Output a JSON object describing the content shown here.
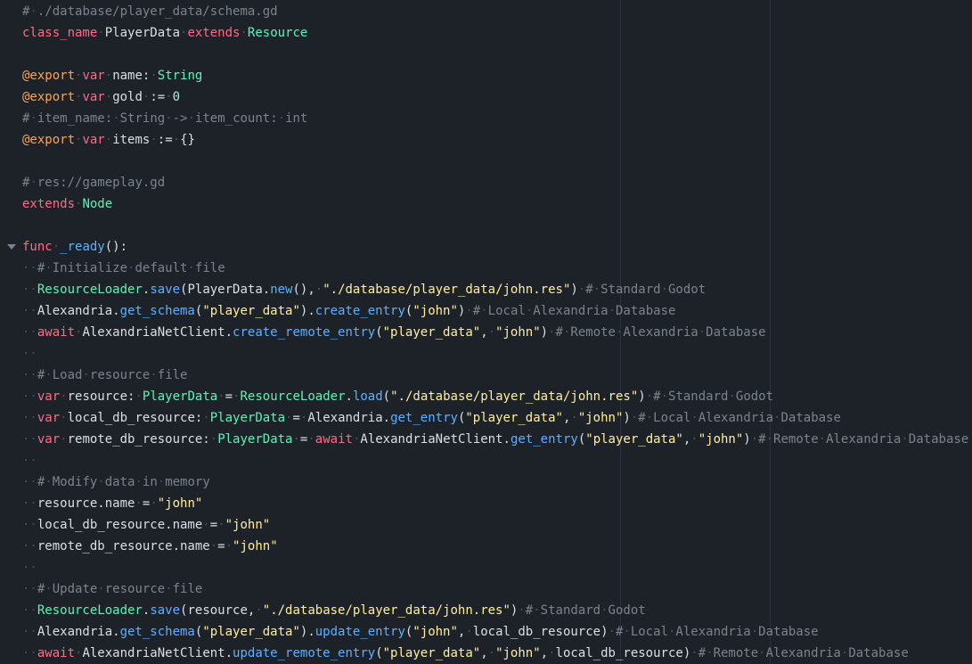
{
  "editor": {
    "colors": {
      "background": "#1d2229",
      "comment": "#7c838d",
      "keyword": "#ff6b84",
      "type": "#5ff2b6",
      "annotation": "#f7a35c",
      "function": "#5db0ff",
      "string": "#ffeea0",
      "number": "#a4f0d2",
      "text": "#dcdfe4",
      "whitespace_dot": "#4a515c"
    },
    "fold_icon": "chevron-down-icon",
    "lines": [
      {
        "indent": 0,
        "tokens": [
          [
            "c",
            "# ./database/player_data/schema.gd"
          ]
        ]
      },
      {
        "indent": 0,
        "tokens": [
          [
            "k",
            "class_name"
          ],
          [
            "t",
            " PlayerData "
          ],
          [
            "k",
            "extends"
          ],
          [
            "t",
            " "
          ],
          [
            "ty",
            "Resource"
          ]
        ]
      },
      {
        "indent": 0,
        "tokens": []
      },
      {
        "indent": 0,
        "tokens": [
          [
            "an",
            "@export"
          ],
          [
            "t",
            " "
          ],
          [
            "k",
            "var"
          ],
          [
            "t",
            " name: "
          ],
          [
            "ty",
            "String"
          ]
        ]
      },
      {
        "indent": 0,
        "tokens": [
          [
            "an",
            "@export"
          ],
          [
            "t",
            " "
          ],
          [
            "k",
            "var"
          ],
          [
            "t",
            " gold := "
          ],
          [
            "num",
            "0"
          ]
        ]
      },
      {
        "indent": 0,
        "tokens": [
          [
            "c",
            "# item_name: String -> item_count: int"
          ]
        ]
      },
      {
        "indent": 0,
        "tokens": [
          [
            "an",
            "@export"
          ],
          [
            "t",
            " "
          ],
          [
            "k",
            "var"
          ],
          [
            "t",
            " items := {}"
          ]
        ]
      },
      {
        "indent": 0,
        "tokens": []
      },
      {
        "indent": 0,
        "tokens": [
          [
            "c",
            "# res://gameplay.gd"
          ]
        ]
      },
      {
        "indent": 0,
        "tokens": [
          [
            "k",
            "extends"
          ],
          [
            "t",
            " "
          ],
          [
            "ty",
            "Node"
          ]
        ]
      },
      {
        "indent": 0,
        "tokens": []
      },
      {
        "indent": 0,
        "fold": true,
        "tokens": [
          [
            "k",
            "func"
          ],
          [
            "t",
            " "
          ],
          [
            "fn",
            "_ready"
          ],
          [
            "t",
            "():"
          ]
        ]
      },
      {
        "indent": 1,
        "tokens": [
          [
            "c",
            "# Initialize default file"
          ]
        ]
      },
      {
        "indent": 1,
        "tokens": [
          [
            "ty",
            "ResourceLoader"
          ],
          [
            "t",
            "."
          ],
          [
            "fn",
            "save"
          ],
          [
            "t",
            "(PlayerData."
          ],
          [
            "fn",
            "new"
          ],
          [
            "t",
            "(), "
          ],
          [
            "str",
            "\"./database/player_data/john.res\""
          ],
          [
            "t",
            ") "
          ],
          [
            "c",
            "# Standard Godot"
          ]
        ]
      },
      {
        "indent": 1,
        "tokens": [
          [
            "t",
            "Alexandria."
          ],
          [
            "fn",
            "get_schema"
          ],
          [
            "t",
            "("
          ],
          [
            "str",
            "\"player_data\""
          ],
          [
            "t",
            ")."
          ],
          [
            "fn",
            "create_entry"
          ],
          [
            "t",
            "("
          ],
          [
            "str",
            "\"john\""
          ],
          [
            "t",
            ") "
          ],
          [
            "c",
            "# Local Alexandria Database"
          ]
        ]
      },
      {
        "indent": 1,
        "tokens": [
          [
            "k",
            "await"
          ],
          [
            "t",
            " AlexandriaNetClient."
          ],
          [
            "fn",
            "create_remote_entry"
          ],
          [
            "t",
            "("
          ],
          [
            "str",
            "\"player_data\""
          ],
          [
            "t",
            ", "
          ],
          [
            "str",
            "\"john\""
          ],
          [
            "t",
            ") "
          ],
          [
            "c",
            "# Remote Alexandria Database"
          ]
        ]
      },
      {
        "indent": 1,
        "tokens": []
      },
      {
        "indent": 1,
        "tokens": [
          [
            "c",
            "# Load resource file"
          ]
        ]
      },
      {
        "indent": 1,
        "tokens": [
          [
            "k",
            "var"
          ],
          [
            "t",
            " resource: "
          ],
          [
            "ty",
            "PlayerData"
          ],
          [
            "t",
            " = "
          ],
          [
            "ty",
            "ResourceLoader"
          ],
          [
            "t",
            "."
          ],
          [
            "fn",
            "load"
          ],
          [
            "t",
            "("
          ],
          [
            "str",
            "\"./database/player_data/john.res\""
          ],
          [
            "t",
            ") "
          ],
          [
            "c",
            "# Standard Godot"
          ]
        ]
      },
      {
        "indent": 1,
        "tokens": [
          [
            "k",
            "var"
          ],
          [
            "t",
            " local_db_resource: "
          ],
          [
            "ty",
            "PlayerData"
          ],
          [
            "t",
            " = Alexandria."
          ],
          [
            "fn",
            "get_entry"
          ],
          [
            "t",
            "("
          ],
          [
            "str",
            "\"player_data\""
          ],
          [
            "t",
            ", "
          ],
          [
            "str",
            "\"john\""
          ],
          [
            "t",
            ") "
          ],
          [
            "c",
            "# Local Alexandria Database"
          ]
        ]
      },
      {
        "indent": 1,
        "tokens": [
          [
            "k",
            "var"
          ],
          [
            "t",
            " remote_db_resource: "
          ],
          [
            "ty",
            "PlayerData"
          ],
          [
            "t",
            " = "
          ],
          [
            "k",
            "await"
          ],
          [
            "t",
            " AlexandriaNetClient."
          ],
          [
            "fn",
            "get_entry"
          ],
          [
            "t",
            "("
          ],
          [
            "str",
            "\"player_data\""
          ],
          [
            "t",
            ", "
          ],
          [
            "str",
            "\"john\""
          ],
          [
            "t",
            ") "
          ],
          [
            "c",
            "# Remote Alexandria Database"
          ]
        ]
      },
      {
        "indent": 1,
        "tokens": []
      },
      {
        "indent": 1,
        "tokens": [
          [
            "c",
            "# Modify data in memory"
          ]
        ]
      },
      {
        "indent": 1,
        "tokens": [
          [
            "t",
            "resource.name = "
          ],
          [
            "str",
            "\"john\""
          ]
        ]
      },
      {
        "indent": 1,
        "tokens": [
          [
            "t",
            "local_db_resource.name = "
          ],
          [
            "str",
            "\"john\""
          ]
        ]
      },
      {
        "indent": 1,
        "tokens": [
          [
            "t",
            "remote_db_resource.name = "
          ],
          [
            "str",
            "\"john\""
          ]
        ]
      },
      {
        "indent": 1,
        "tokens": []
      },
      {
        "indent": 1,
        "tokens": [
          [
            "c",
            "# Update resource file"
          ]
        ]
      },
      {
        "indent": 1,
        "tokens": [
          [
            "ty",
            "ResourceLoader"
          ],
          [
            "t",
            "."
          ],
          [
            "fn",
            "save"
          ],
          [
            "t",
            "(resource, "
          ],
          [
            "str",
            "\"./database/player_data/john.res\""
          ],
          [
            "t",
            ") "
          ],
          [
            "c",
            "# Standard Godot"
          ]
        ]
      },
      {
        "indent": 1,
        "tokens": [
          [
            "t",
            "Alexandria."
          ],
          [
            "fn",
            "get_schema"
          ],
          [
            "t",
            "("
          ],
          [
            "str",
            "\"player_data\""
          ],
          [
            "t",
            ")."
          ],
          [
            "fn",
            "update_entry"
          ],
          [
            "t",
            "("
          ],
          [
            "str",
            "\"john\""
          ],
          [
            "t",
            ", local_db_resource) "
          ],
          [
            "c",
            "# Local Alexandria Database"
          ]
        ]
      },
      {
        "indent": 1,
        "tokens": [
          [
            "k",
            "await"
          ],
          [
            "t",
            " AlexandriaNetClient."
          ],
          [
            "fn",
            "update_remote_entry"
          ],
          [
            "t",
            "("
          ],
          [
            "str",
            "\"player_data\""
          ],
          [
            "t",
            ", "
          ],
          [
            "str",
            "\"john\""
          ],
          [
            "t",
            ", local_db_resource) "
          ],
          [
            "c",
            "# Remote Alexandria Database"
          ]
        ]
      }
    ]
  }
}
